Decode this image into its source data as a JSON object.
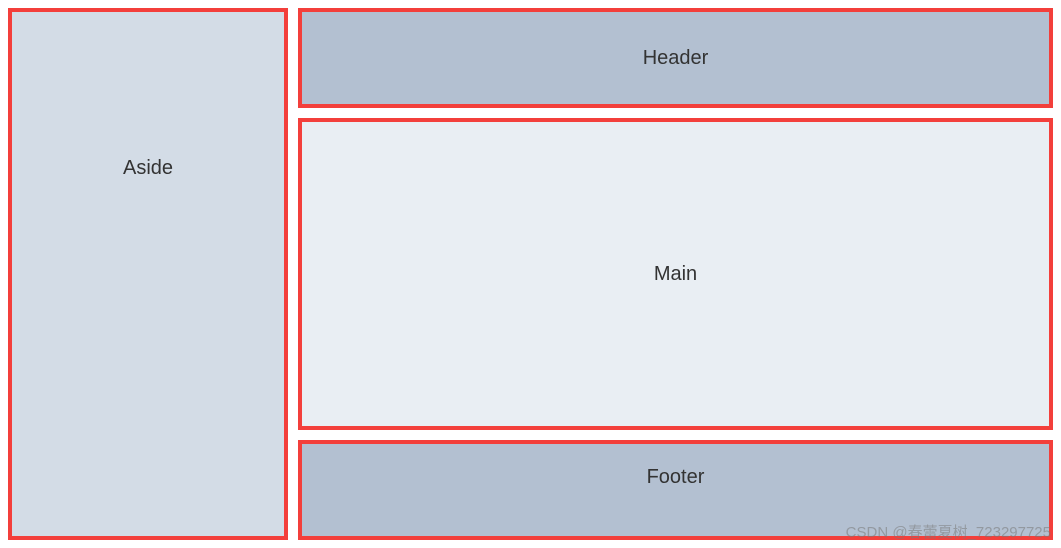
{
  "layout": {
    "aside": "Aside",
    "header": "Header",
    "main": "Main",
    "footer": "Footer"
  },
  "watermark": "CSDN @春蕾夏树_723297725"
}
